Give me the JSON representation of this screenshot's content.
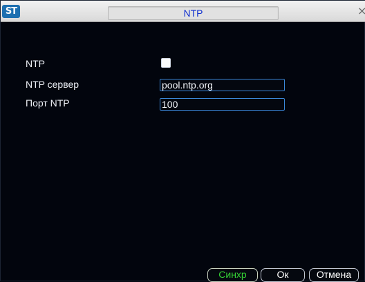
{
  "window": {
    "title": "NTP",
    "logo_text": "ST",
    "close_glyph": "×"
  },
  "form": {
    "ntp_label": "NTP",
    "ntp_enabled": false,
    "server_label": "NTP сервер",
    "server_value": "pool.ntp.org",
    "port_label": "Порт NTP",
    "port_value": "100"
  },
  "buttons": {
    "sync_label": "Синхр",
    "ok_label": "Ок",
    "cancel_label": "Отмена"
  },
  "colors": {
    "title_text": "#1030d0",
    "sync_text": "#35d235",
    "field_border": "#3a86d8",
    "background": "#02050d"
  },
  "icons": {
    "logo": "app-logo-icon",
    "close": "close-icon"
  }
}
